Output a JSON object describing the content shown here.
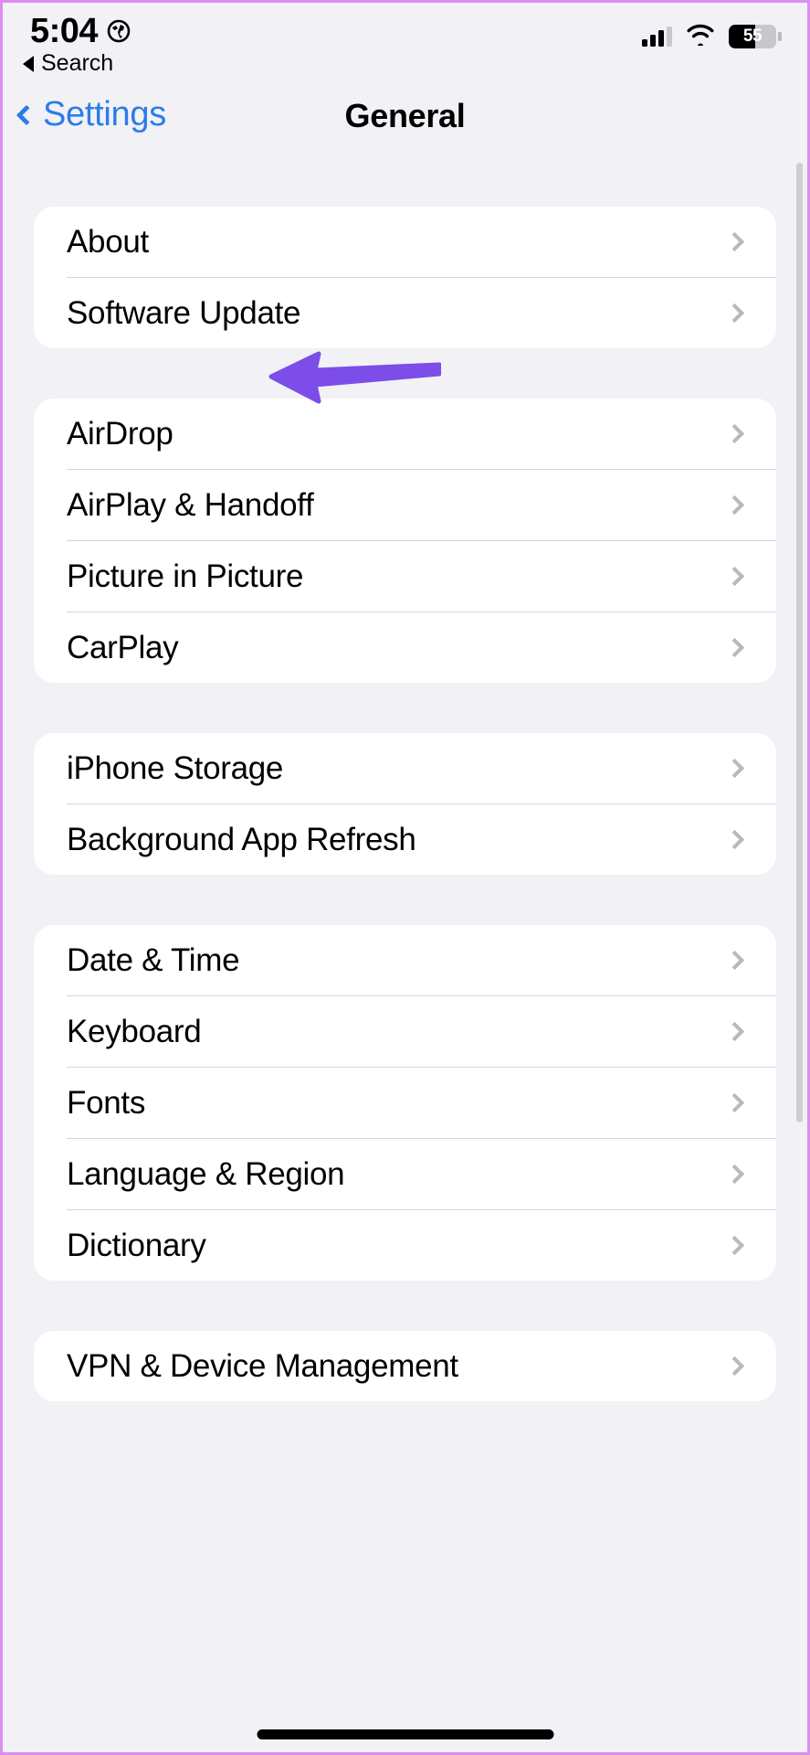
{
  "meta": {
    "accent_blue": "#2b7ce9",
    "annotation_purple": "#7c4de8",
    "background": "#f2f1f6",
    "card": "#ffffff",
    "frame_border": "#d98ff0"
  },
  "status_bar": {
    "time": "5:04",
    "location_icon": "globe-icon",
    "cellular_icon": "signal-bars-icon",
    "wifi_icon": "wifi-icon",
    "battery_percent": "55",
    "battery_level": 55
  },
  "back_to_app": {
    "icon": "triangle-left-icon",
    "label": "Search"
  },
  "nav_bar": {
    "back_icon": "chevron-left-icon",
    "back_label": "Settings",
    "title": "General"
  },
  "annotation": {
    "type": "arrow",
    "direction": "left",
    "color": "#7c4de8",
    "target": "Software Update"
  },
  "groups": [
    {
      "id": "group-system",
      "rows": [
        {
          "label": "About",
          "accessory": "chevron-right-icon"
        },
        {
          "label": "Software Update",
          "accessory": "chevron-right-icon"
        }
      ]
    },
    {
      "id": "group-connectivity",
      "rows": [
        {
          "label": "AirDrop",
          "accessory": "chevron-right-icon"
        },
        {
          "label": "AirPlay & Handoff",
          "accessory": "chevron-right-icon"
        },
        {
          "label": "Picture in Picture",
          "accessory": "chevron-right-icon"
        },
        {
          "label": "CarPlay",
          "accessory": "chevron-right-icon"
        }
      ]
    },
    {
      "id": "group-storage",
      "rows": [
        {
          "label": "iPhone Storage",
          "accessory": "chevron-right-icon"
        },
        {
          "label": "Background App Refresh",
          "accessory": "chevron-right-icon"
        }
      ]
    },
    {
      "id": "group-localization",
      "rows": [
        {
          "label": "Date & Time",
          "accessory": "chevron-right-icon"
        },
        {
          "label": "Keyboard",
          "accessory": "chevron-right-icon"
        },
        {
          "label": "Fonts",
          "accessory": "chevron-right-icon"
        },
        {
          "label": "Language & Region",
          "accessory": "chevron-right-icon"
        },
        {
          "label": "Dictionary",
          "accessory": "chevron-right-icon"
        }
      ]
    },
    {
      "id": "group-management",
      "rows": [
        {
          "label": "VPN & Device Management",
          "accessory": "chevron-right-icon"
        }
      ]
    }
  ]
}
